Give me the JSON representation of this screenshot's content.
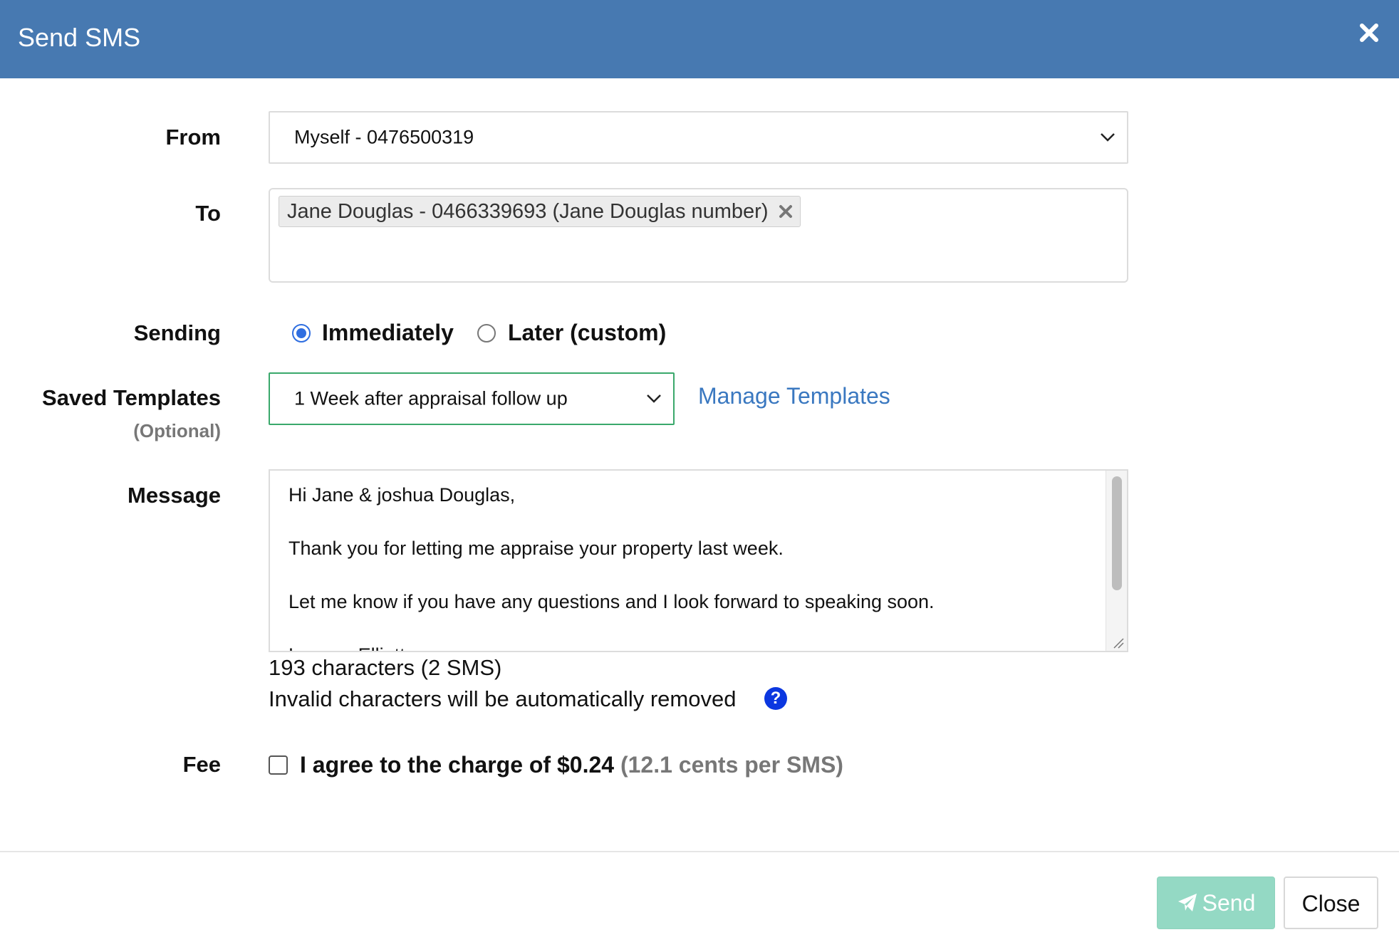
{
  "dialog": {
    "title": "Send SMS"
  },
  "form": {
    "from": {
      "label": "From",
      "value": "Myself - 0476500319"
    },
    "to": {
      "label": "To",
      "recipients": [
        {
          "text": "Jane Douglas - 0466339693 (Jane Douglas number)"
        }
      ]
    },
    "sending": {
      "label": "Sending",
      "options": [
        {
          "label": "Immediately",
          "selected": true
        },
        {
          "label": "Later (custom)",
          "selected": false
        }
      ]
    },
    "templates": {
      "label": "Saved Templates",
      "sublabel": "(Optional)",
      "selected": "1 Week after appraisal follow up",
      "manage_link": "Manage Templates"
    },
    "message": {
      "label": "Message",
      "value": "Hi Jane & joshua Douglas,\n\nThank you for letting me appraise your property last week.\n\nLet me know if you have any questions and I look forward to speaking soon.\n\nLeanne Elliott",
      "char_count": "193 characters (2 SMS)",
      "invalid_note": "Invalid characters will be automatically removed",
      "help_glyph": "?"
    },
    "fee": {
      "label": "Fee",
      "agree_text": "I agree to the charge of $0.24",
      "rate_text": "(12.1 cents per SMS)",
      "checked": false
    }
  },
  "footer": {
    "send_label": "Send",
    "close_label": "Close"
  },
  "colors": {
    "header_bg": "#4779b1",
    "link": "#3a78c0",
    "send_button_bg": "#94d9c4",
    "radio_accent": "#2f6ee0",
    "help_icon_bg": "#0b37e0",
    "template_border": "#3aa86b"
  }
}
